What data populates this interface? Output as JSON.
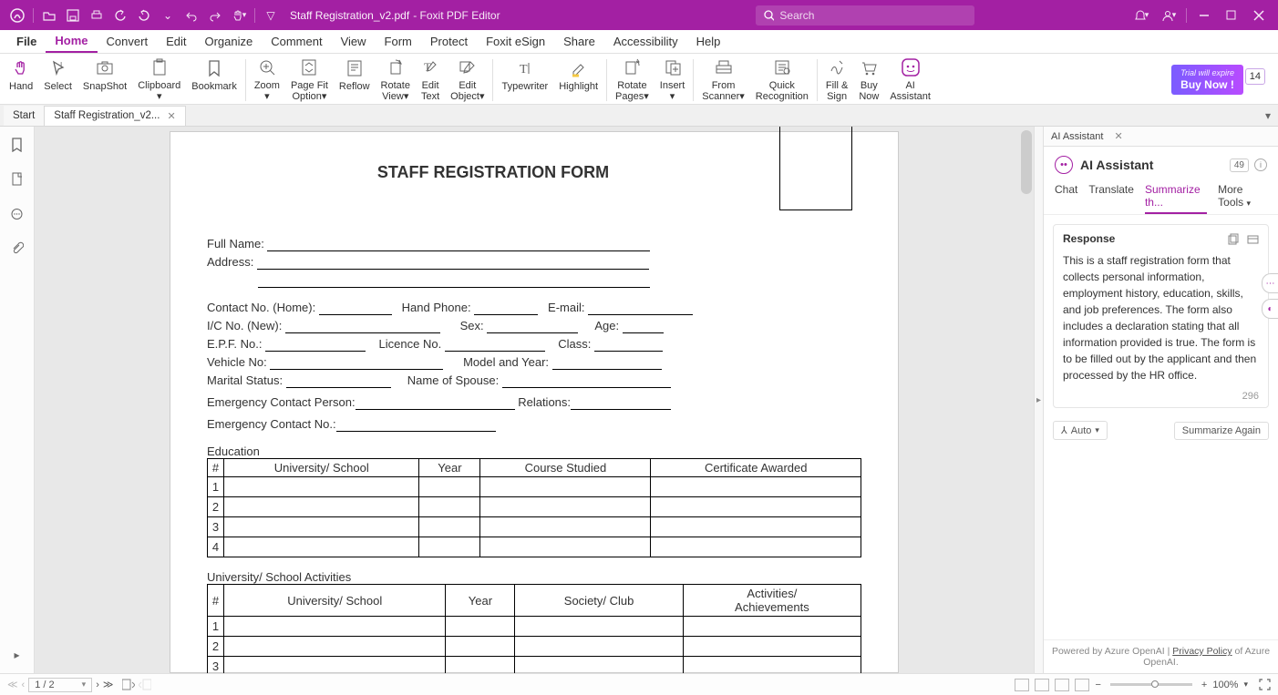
{
  "titlebar": {
    "doc_title": "Staff Registration_v2.pdf",
    "product": "Foxit PDF Editor",
    "search_placeholder": "Search"
  },
  "menubar": {
    "file": "File",
    "items": [
      "Home",
      "Convert",
      "Edit",
      "Organize",
      "Comment",
      "View",
      "Form",
      "Protect",
      "Foxit eSign",
      "Share",
      "Accessibility",
      "Help"
    ],
    "active_index": 0
  },
  "ribbon": {
    "buttons": [
      {
        "id": "hand",
        "label": "Hand"
      },
      {
        "id": "select",
        "label": "Select"
      },
      {
        "id": "snapshot",
        "label": "SnapShot"
      },
      {
        "id": "clipboard",
        "label": "Clipboard\n▾"
      },
      {
        "id": "bookmark",
        "label": "Bookmark"
      },
      {
        "id": "zoom",
        "label": "Zoom\n▾"
      },
      {
        "id": "pagefit",
        "label": "Page Fit\nOption▾"
      },
      {
        "id": "reflow",
        "label": "Reflow"
      },
      {
        "id": "rotateview",
        "label": "Rotate\nView▾"
      },
      {
        "id": "edittext",
        "label": "Edit\nText"
      },
      {
        "id": "editobject",
        "label": "Edit\nObject▾"
      },
      {
        "id": "typewriter",
        "label": "Typewriter"
      },
      {
        "id": "highlight",
        "label": "Highlight"
      },
      {
        "id": "rotatepages",
        "label": "Rotate\nPages▾"
      },
      {
        "id": "insert",
        "label": "Insert\n▾"
      },
      {
        "id": "fromscanner",
        "label": "From\nScanner▾"
      },
      {
        "id": "quickrec",
        "label": "Quick\nRecognition"
      },
      {
        "id": "fillsign",
        "label": "Fill &\nSign"
      },
      {
        "id": "buynow",
        "label": "Buy\nNow"
      },
      {
        "id": "aiassist",
        "label": "AI\nAssistant"
      }
    ],
    "trial": {
      "line1": "Trial will expire",
      "line2": "Buy Now !",
      "days": "14"
    }
  },
  "doctabs": {
    "tabs": [
      {
        "label": "Start",
        "closable": false
      },
      {
        "label": "Staff Registration_v2...",
        "closable": true
      }
    ],
    "active_index": 1
  },
  "page": {
    "title": "STAFF REGISTRATION FORM",
    "labels": {
      "full_name": "Full Name:",
      "address": "Address:",
      "contact_home": "Contact No. (Home):",
      "hand_phone": "Hand Phone:",
      "email": "E-mail:",
      "ic_new": "I/C No. (New):",
      "sex": "Sex:",
      "age": "Age:",
      "epf": "E.P.F. No.:",
      "licence": "Licence No.",
      "class": "Class:",
      "vehicle": "Vehicle No:",
      "model_year": "Model and Year:",
      "marital": "Marital Status:",
      "spouse": "Name of Spouse:",
      "emc_person": "Emergency Contact Person:",
      "relations": "Relations:",
      "emc_no": "Emergency Contact No.:",
      "education": "Education",
      "activities": "University/ School Activities"
    },
    "edu_headers": [
      "#",
      "University/ School",
      "Year",
      "Course Studied",
      "Certificate Awarded"
    ],
    "act_headers": [
      "#",
      "University/ School",
      "Year",
      "Society/ Club",
      "Activities/\nAchievements"
    ],
    "edu_rows": 4,
    "act_rows_visible": 3
  },
  "ai": {
    "tab_label": "AI Assistant",
    "title": "AI Assistant",
    "trial_count": "49",
    "tabs": {
      "chat": "Chat",
      "translate": "Translate",
      "summarize": "Summarize th...",
      "more": "More Tools"
    },
    "response_label": "Response",
    "response_body": "This is a staff registration form that collects personal information, employment history, education, skills, and job preferences. The form also includes a declaration stating that all information provided is true. The form is to be filled out by the applicant and then processed by the HR office.",
    "token_count": "296",
    "auto_label": "Auto",
    "summarize_again": "Summarize Again",
    "footer_prefix": "Powered by Azure OpenAI | ",
    "footer_link": "Privacy Policy",
    "footer_suffix": " of Azure OpenAI."
  },
  "statusbar": {
    "page": "1 / 2",
    "zoom": "100%"
  }
}
